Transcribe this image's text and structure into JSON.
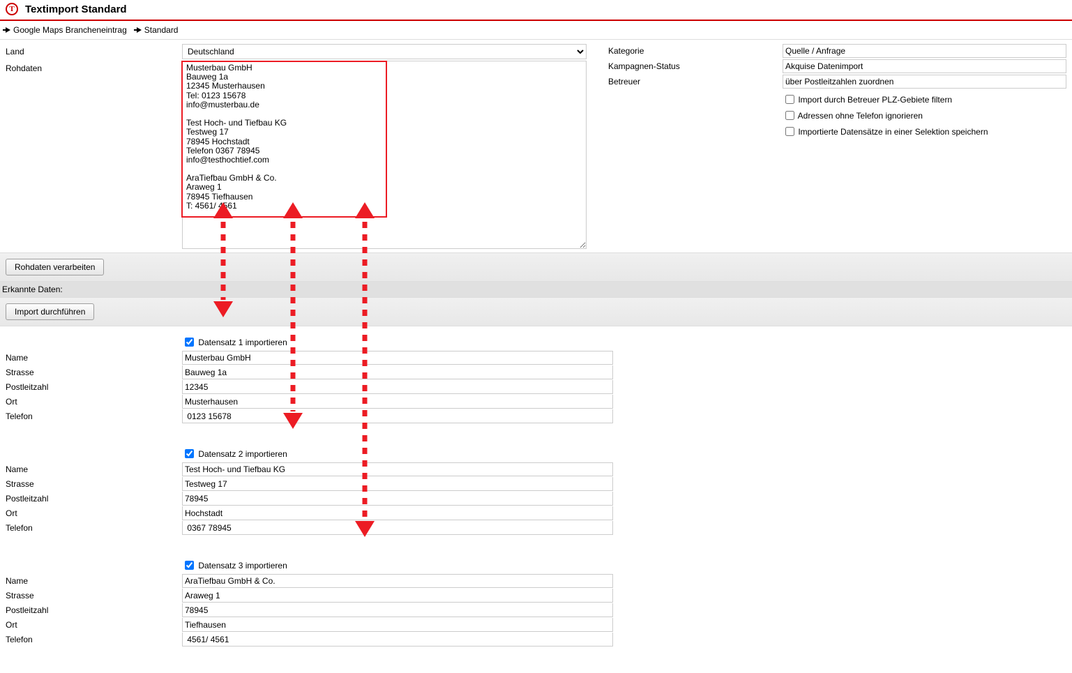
{
  "header": {
    "title": "Textimport Standard"
  },
  "breadcrumb": {
    "items": [
      "Google Maps Brancheneintrag",
      "Standard"
    ]
  },
  "left": {
    "land_label": "Land",
    "land_value": "Deutschland",
    "rohdaten_label": "Rohdaten",
    "rohdaten_value": "Musterbau GmbH\nBauweg 1a\n12345 Musterhausen\nTel: 0123 15678\ninfo@musterbau.de\n\nTest Hoch- und Tiefbau KG\nTestweg 17\n78945 Hochstadt\nTelefon 0367 78945\ninfo@testhochtief.com\n\nAraTiefbau GmbH & Co.\nAraweg 1\n78945 Tiefhausen\nT: 4561/ 4561",
    "btn_process": "Rohdaten verarbeiten",
    "erkannte": "Erkannte Daten:",
    "btn_import": "Import durchführen"
  },
  "right": {
    "kategorie_label": "Kategorie",
    "kategorie_value": "Quelle / Anfrage",
    "kampagnen_label": "Kampagnen-Status",
    "kampagnen_value": "Akquise Datenimport",
    "betreuer_label": "Betreuer",
    "betreuer_value": "über Postleitzahlen zuordnen",
    "opt1": "Import durch Betreuer PLZ-Gebiete filtern",
    "opt2": "Adressen ohne Telefon ignorieren",
    "opt3": "Importierte Datensätze in einer Selektion speichern"
  },
  "field_labels": {
    "name": "Name",
    "strasse": "Strasse",
    "plz": "Postleitzahl",
    "ort": "Ort",
    "telefon": "Telefon"
  },
  "records": [
    {
      "cb_label": "Datensatz 1 importieren",
      "name": "Musterbau GmbH",
      "strasse": "Bauweg 1a",
      "plz": "12345",
      "ort": "Musterhausen",
      "telefon": " 0123 15678"
    },
    {
      "cb_label": "Datensatz 2 importieren",
      "name": "Test Hoch- und Tiefbau KG",
      "strasse": "Testweg 17",
      "plz": "78945",
      "ort": "Hochstadt",
      "telefon": " 0367 78945"
    },
    {
      "cb_label": "Datensatz 3 importieren",
      "name": "AraTiefbau GmbH & Co.",
      "strasse": "Araweg 1",
      "plz": "78945",
      "ort": "Tiefhausen",
      "telefon": " 4561/ 4561"
    }
  ]
}
